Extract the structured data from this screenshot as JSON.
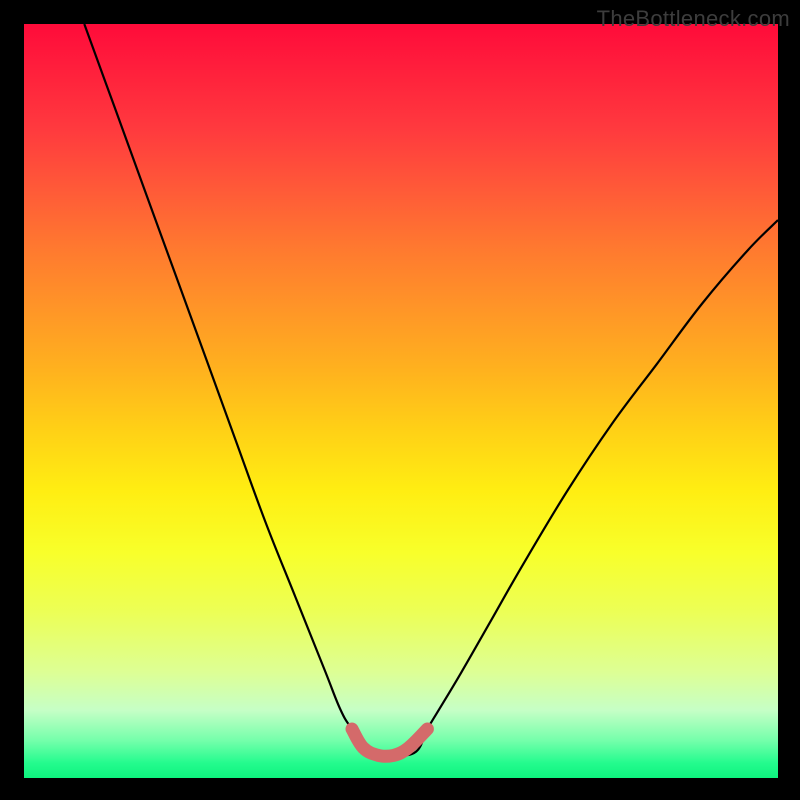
{
  "watermark": "TheBottleneck.com",
  "chart_data": {
    "type": "line",
    "title": "",
    "xlabel": "",
    "ylabel": "",
    "xlim": [
      0,
      100
    ],
    "ylim": [
      0,
      100
    ],
    "grid": false,
    "legend": false,
    "series": [
      {
        "name": "bottleneck-curve",
        "color": "#000000",
        "x": [
          8,
          12,
          16,
          20,
          24,
          28,
          32,
          36,
          40,
          42,
          43.5,
          46,
          49,
          52,
          53.5,
          55,
          58,
          62,
          66,
          72,
          78,
          84,
          90,
          96,
          100
        ],
        "y": [
          100,
          89,
          78,
          67,
          56,
          45,
          34,
          24,
          14,
          9,
          6.5,
          3.5,
          3,
          3.5,
          6.5,
          9,
          14,
          21,
          28,
          38,
          47,
          55,
          63,
          70,
          74
        ]
      },
      {
        "name": "optimal-zone",
        "color": "#d46a6a",
        "x": [
          43.5,
          45,
          47,
          49,
          51,
          53.5
        ],
        "y": [
          6.5,
          4,
          3,
          3,
          4,
          6.5
        ]
      }
    ],
    "gradient_stops": [
      {
        "offset": 0,
        "color": "#ff0b3a"
      },
      {
        "offset": 50,
        "color": "#ffd116"
      },
      {
        "offset": 100,
        "color": "#0ef37e"
      }
    ]
  }
}
